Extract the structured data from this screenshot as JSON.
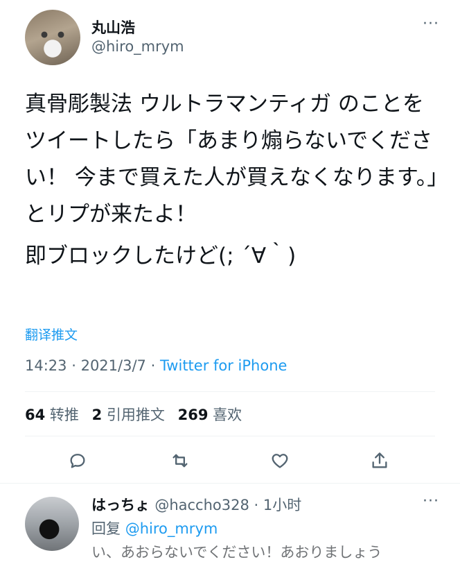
{
  "tweet": {
    "author_name": "丸山浩",
    "author_handle": "@hiro_mrym",
    "more": "···",
    "text_p1": "真骨彫製法 ウルトラマンティガ のことをツイートしたら「あまり煽らないでください！ 今まで買えた人が買えなくなります。」とリプが来たよ！",
    "text_p2": "即ブロックしたけど(; ´∀｀)",
    "translate": "翻译推文",
    "time": "14:23",
    "date": "2021/3/7",
    "source": "Twitter for iPhone",
    "retweets_count": "64",
    "retweets_label": "转推",
    "quotes_count": "2",
    "quotes_label": "引用推文",
    "likes_count": "269",
    "likes_label": "喜欢"
  },
  "actions": {
    "reply_icon": "reply-icon",
    "retweet_icon": "retweet-icon",
    "like_icon": "heart-icon",
    "share_icon": "share-icon"
  },
  "reply": {
    "author_name": "はっちょ",
    "author_handle": "@haccho328",
    "time_ago": "1小时",
    "more": "···",
    "reply_to_label": "回复",
    "reply_to_handle": "@hiro_mrym",
    "text_preview": "い、あおらないでください！あおりましょう"
  },
  "colors": {
    "accent": "#1d9bf0",
    "secondary_text": "#536471",
    "primary_text": "#0f1419"
  }
}
